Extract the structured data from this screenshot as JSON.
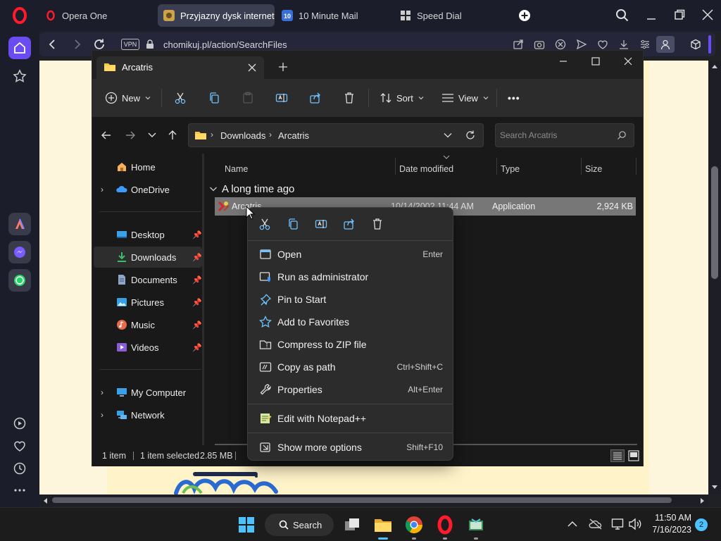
{
  "browser": {
    "brand_tab": "Opera One",
    "tabs": [
      {
        "label": "Przyjazny dysk internetowy"
      },
      {
        "label": "10 Minute Mail"
      },
      {
        "label": "Speed Dial"
      }
    ],
    "vpn_label": "VPN",
    "url": "chomikuj.pl/action/SearchFiles"
  },
  "explorer": {
    "tab_title": "Arcatris",
    "toolbar": {
      "new_label": "New",
      "sort_label": "Sort",
      "view_label": "View",
      "more_label": "•••"
    },
    "breadcrumb": [
      "Downloads",
      "Arcatris"
    ],
    "search_placeholder": "Search Arcatris",
    "nav": {
      "home": "Home",
      "onedrive": "OneDrive",
      "pinned": [
        "Desktop",
        "Downloads",
        "Documents",
        "Pictures",
        "Music",
        "Videos"
      ],
      "my_computer": "My Computer",
      "network": "Network"
    },
    "columns": {
      "name": "Name",
      "date": "Date modified",
      "type": "Type",
      "size": "Size"
    },
    "group_header": "A long time ago",
    "file": {
      "name": "Arcatris",
      "date": "10/14/2002 11:44 AM",
      "type": "Application",
      "size": "2,924 KB"
    },
    "status": {
      "count": "1 item",
      "selected": "1 item selected",
      "size": "2.85 MB"
    }
  },
  "context_menu": {
    "items": [
      {
        "label": "Open",
        "key": "Enter"
      },
      {
        "label": "Run as administrator",
        "key": ""
      },
      {
        "label": "Pin to Start",
        "key": ""
      },
      {
        "label": "Add to Favorites",
        "key": ""
      },
      {
        "label": "Compress to ZIP file",
        "key": ""
      },
      {
        "label": "Copy as path",
        "key": "Ctrl+Shift+C"
      },
      {
        "label": "Properties",
        "key": "Alt+Enter"
      },
      {
        "label": "Edit with Notepad++",
        "key": ""
      },
      {
        "label": "Show more options",
        "key": "Shift+F10"
      }
    ]
  },
  "taskbar": {
    "search_label": "Search",
    "time": "11:50 AM",
    "date": "7/16/2023",
    "notification_count": "2"
  },
  "colors": {
    "accent": "#4cc2ff",
    "opera_red": "#ff1b2d",
    "selection_gray": "#777777"
  }
}
